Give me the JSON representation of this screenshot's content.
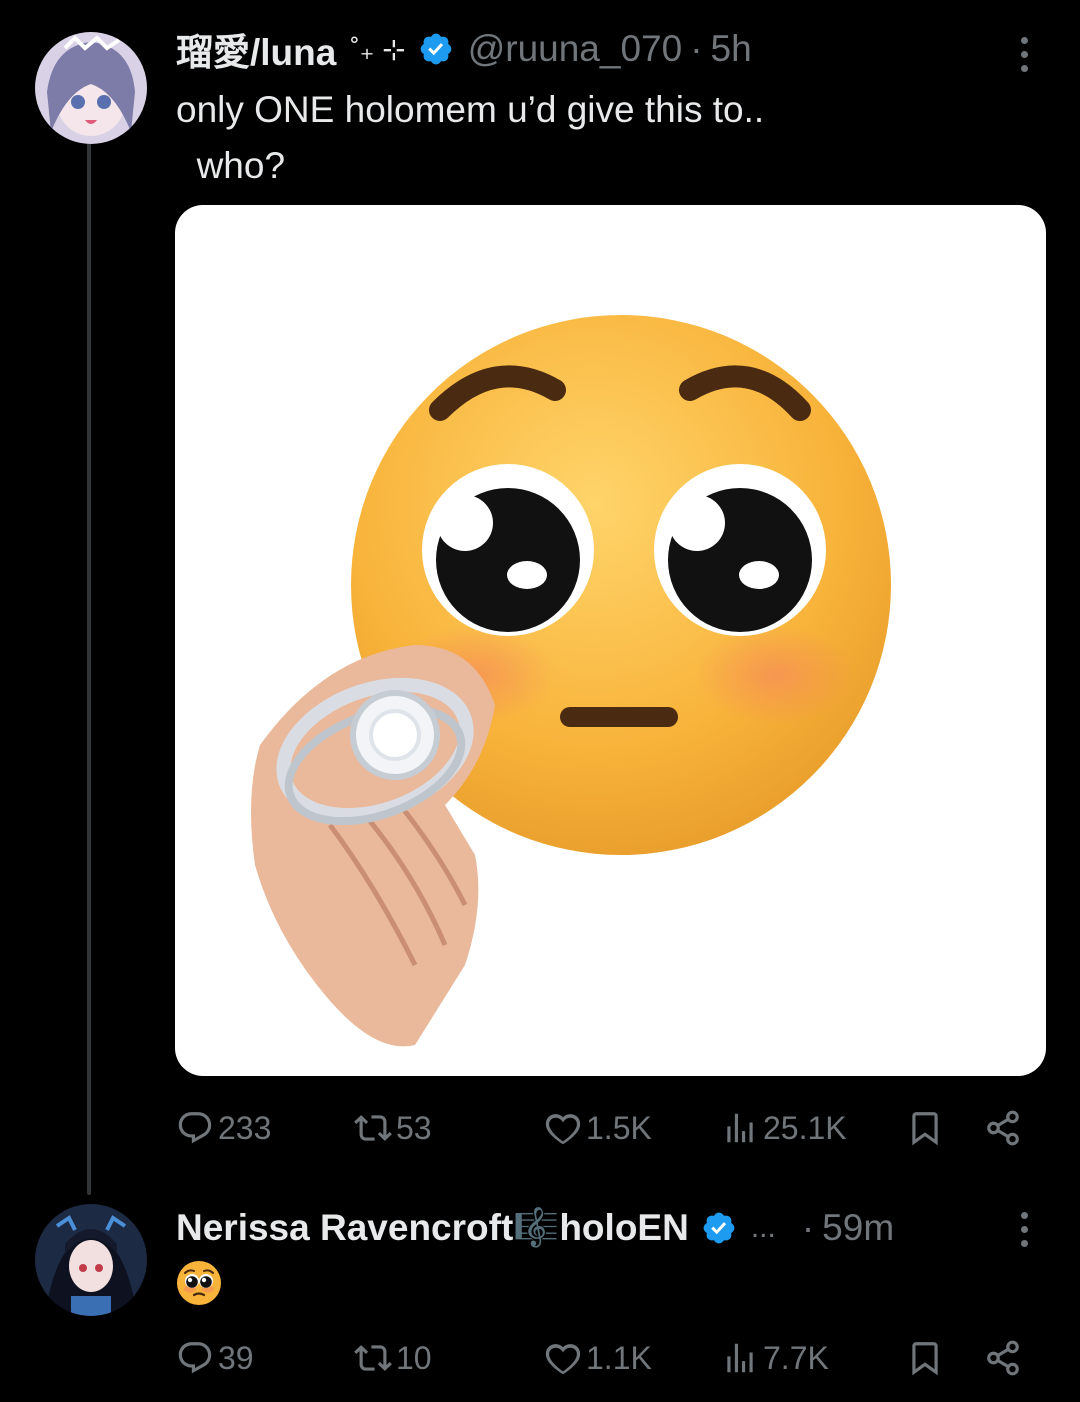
{
  "tweet": {
    "display_name": "瑠愛/luna",
    "name_decoration": "˚₊ ⊹",
    "handle": "@ruuna_070",
    "separator": "·",
    "time": "5h",
    "text": "only ONE holomem u’d give this to..\n  who?",
    "verified": true,
    "stats": {
      "replies": "233",
      "reposts": "53",
      "likes": "1.5K",
      "views": "25.1K"
    }
  },
  "reply": {
    "display_name": "Nerissa Ravencroft🎼holoEN",
    "ellipsis": "...",
    "separator": "·",
    "time": "59m",
    "verified": true,
    "emoji": "pleading-face",
    "stats": {
      "replies": "39",
      "reposts": "10",
      "likes": "1.1K",
      "views": "7.7K"
    }
  },
  "icons": [
    "reply-icon",
    "repost-icon",
    "like-icon",
    "views-icon",
    "bookmark-icon",
    "share-icon",
    "more-icon",
    "verified-badge-icon"
  ],
  "colors": {
    "background": "#000000",
    "text": "#e7e9ea",
    "muted": "#71767b",
    "verified": "#1d9bf0",
    "thread_line": "#333639"
  }
}
